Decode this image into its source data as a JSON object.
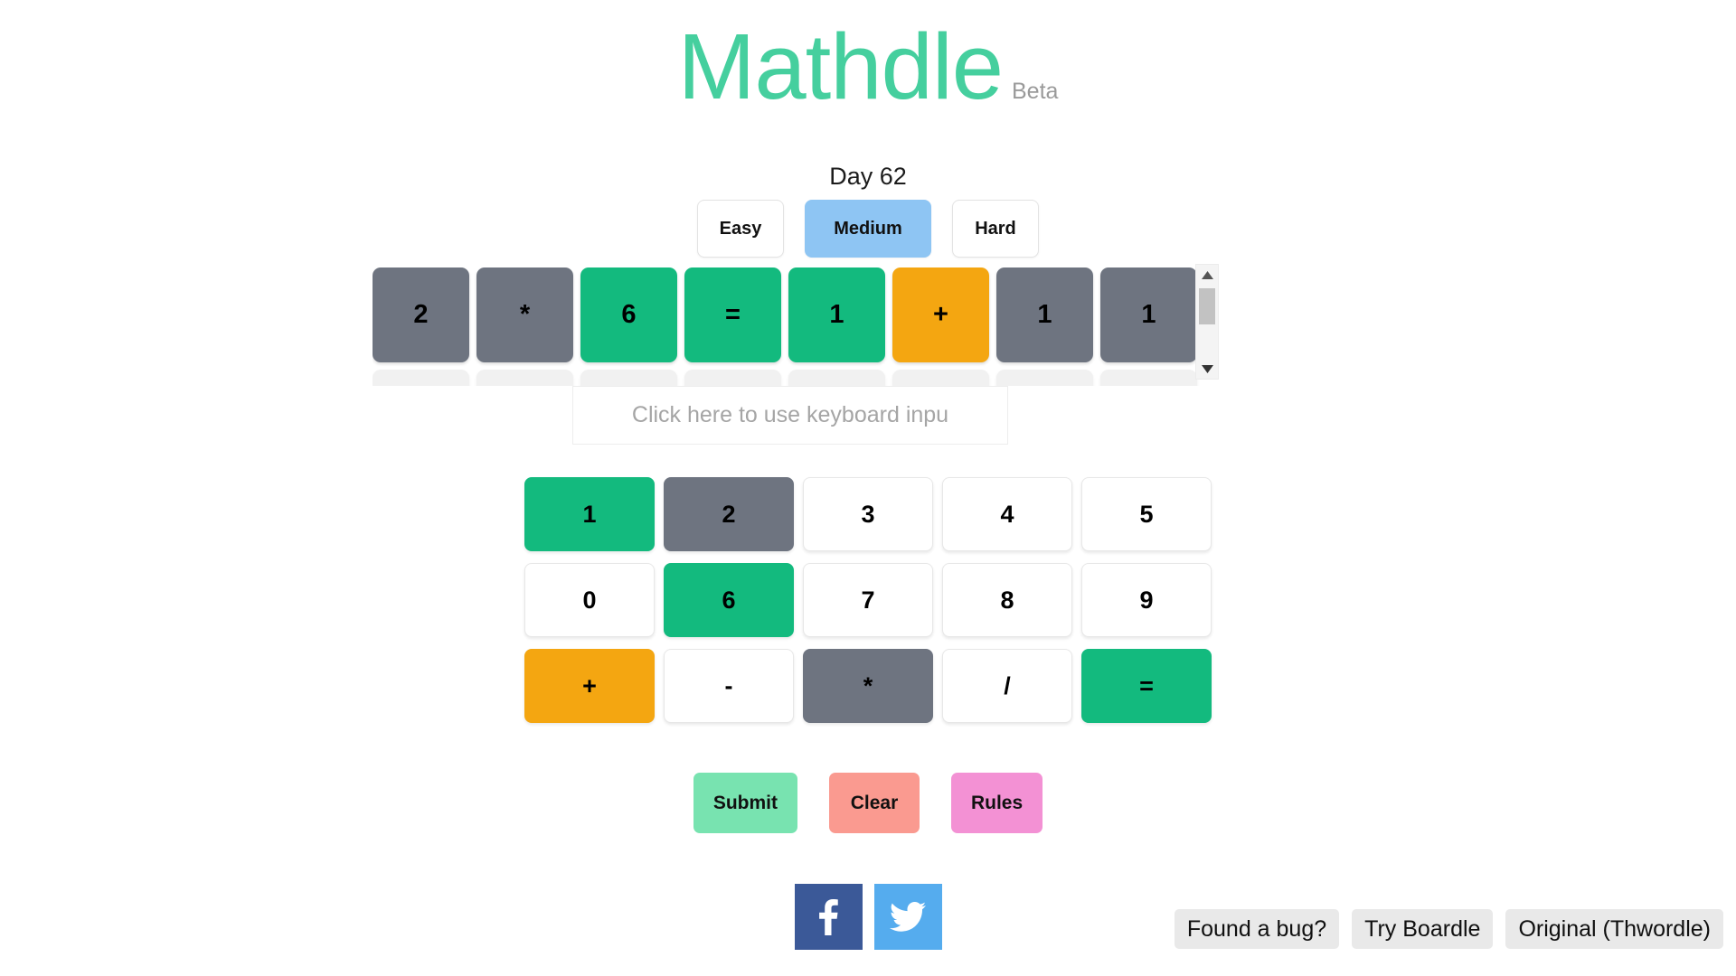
{
  "header": {
    "title": "Mathdle",
    "badge": "Beta",
    "title_color": "#45cf9e",
    "badge_color": "#9a9a9a"
  },
  "day": {
    "label": "Day 62"
  },
  "difficulty": {
    "options": [
      {
        "label": "Easy",
        "selected": false
      },
      {
        "label": "Medium",
        "selected": true
      },
      {
        "label": "Hard",
        "selected": false
      }
    ],
    "selected_color": "#8ec5f3"
  },
  "board": {
    "rows": [
      {
        "tiles": [
          {
            "value": "2",
            "state": "gray"
          },
          {
            "value": "*",
            "state": "gray"
          },
          {
            "value": "6",
            "state": "green"
          },
          {
            "value": "=",
            "state": "green"
          },
          {
            "value": "1",
            "state": "green"
          },
          {
            "value": "+",
            "state": "orange"
          },
          {
            "value": "1",
            "state": "gray"
          },
          {
            "value": "1",
            "state": "gray"
          }
        ]
      },
      {
        "tiles": [
          {
            "value": "",
            "state": "empty"
          },
          {
            "value": "",
            "state": "empty"
          },
          {
            "value": "",
            "state": "empty"
          },
          {
            "value": "",
            "state": "empty"
          },
          {
            "value": "",
            "state": "empty"
          },
          {
            "value": "",
            "state": "empty"
          },
          {
            "value": "",
            "state": "empty"
          },
          {
            "value": "",
            "state": "empty"
          }
        ]
      }
    ],
    "colors": {
      "gray": "#6e7480",
      "green": "#13ba7e",
      "orange": "#f4a611",
      "empty": "#f1f1f1"
    }
  },
  "keyboard_input": {
    "placeholder": "Click here to use keyboard inpu",
    "value": ""
  },
  "keypad": {
    "rows": [
      [
        {
          "label": "1",
          "state": "green"
        },
        {
          "label": "2",
          "state": "gray"
        },
        {
          "label": "3",
          "state": "white"
        },
        {
          "label": "4",
          "state": "white"
        },
        {
          "label": "5",
          "state": "white"
        }
      ],
      [
        {
          "label": "0",
          "state": "white"
        },
        {
          "label": "6",
          "state": "green"
        },
        {
          "label": "7",
          "state": "white"
        },
        {
          "label": "8",
          "state": "white"
        },
        {
          "label": "9",
          "state": "white"
        }
      ],
      [
        {
          "label": "+",
          "state": "orange"
        },
        {
          "label": "-",
          "state": "white"
        },
        {
          "label": "*",
          "state": "gray"
        },
        {
          "label": "/",
          "state": "white"
        },
        {
          "label": "=",
          "state": "green"
        }
      ]
    ]
  },
  "actions": {
    "submit": "Submit",
    "clear": "Clear",
    "rules": "Rules",
    "submit_color": "#78e3b0",
    "clear_color": "#fa9a90",
    "rules_color": "#f391d4"
  },
  "social": {
    "facebook_icon": "facebook-icon",
    "twitter_icon": "twitter-icon",
    "facebook_color": "#3b5998",
    "twitter_color": "#55acee"
  },
  "footer": {
    "links": [
      {
        "label": "Found a bug?"
      },
      {
        "label": "Try Boardle"
      },
      {
        "label": "Original (Thwordle)"
      }
    ]
  },
  "scrollbar": {
    "up_icon": "triangle-up-icon",
    "down_icon": "triangle-down-icon",
    "thumb_position_pct": 6
  }
}
